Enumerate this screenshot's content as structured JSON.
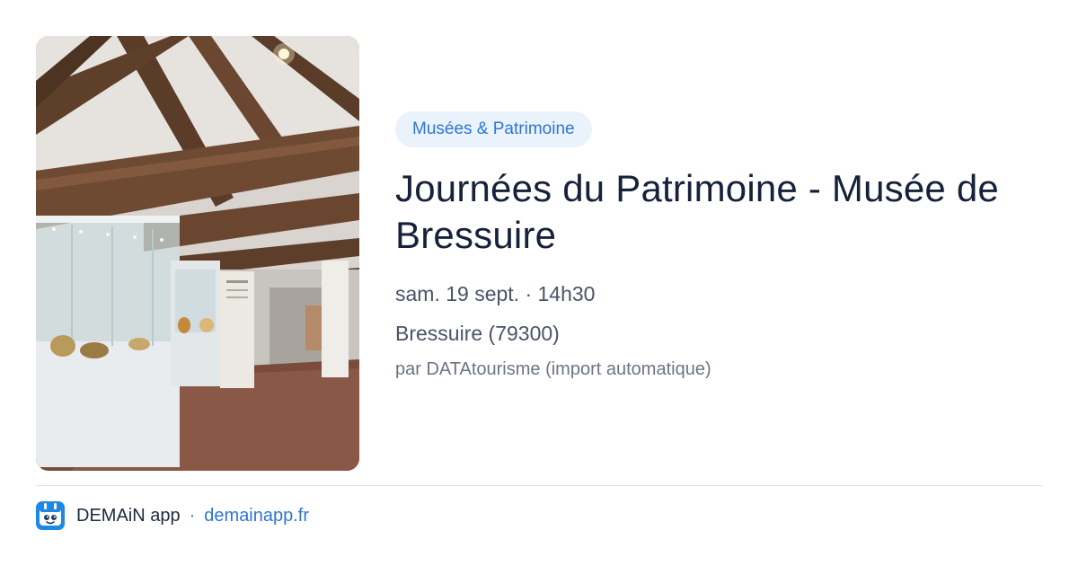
{
  "image": {
    "alt": "Salle du Musée de Bressuire avec charpente en bois et vitrines"
  },
  "event": {
    "category": "Musées & Patrimoine",
    "title": "Journées du Patrimoine - Musée de Bressuire",
    "datetime": "sam. 19 sept. · 14h30",
    "location": "Bressuire (79300)",
    "source": "par DATAtourisme (import automatique)"
  },
  "footer": {
    "app_name": "DEMAiN app",
    "separator": "·",
    "link_text": "demainapp.fr"
  },
  "colors": {
    "accent": "#2f76d2",
    "chip_background": "#eaf2fc",
    "title": "#16213a",
    "body_text": "#4a5466",
    "muted_text": "#6b7584",
    "divider": "#dde4ea"
  },
  "icons": {
    "app_icon": "demain-app-icon"
  }
}
